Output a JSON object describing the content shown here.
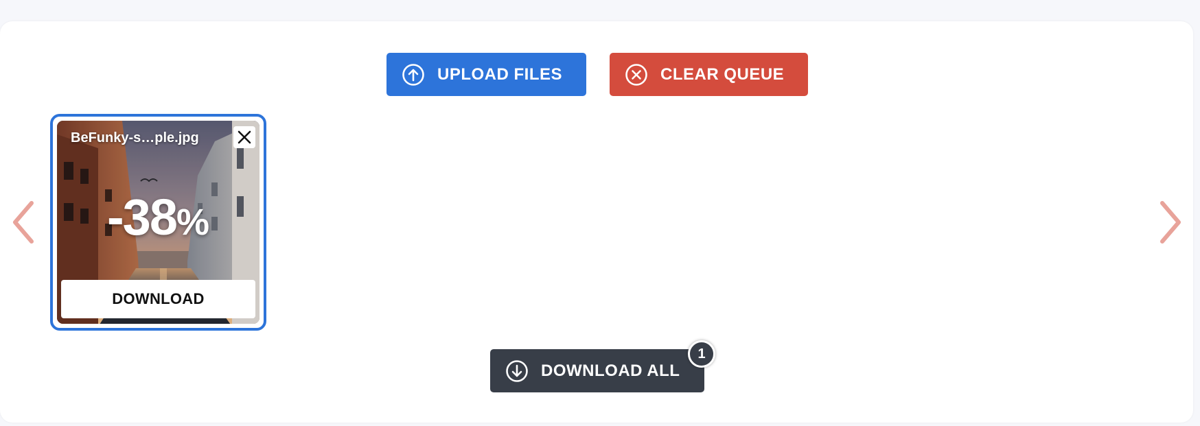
{
  "toolbar": {
    "upload_label": "UPLOAD FILES",
    "clear_label": "CLEAR QUEUE",
    "upload_icon": "arrow-up-circle-icon",
    "clear_icon": "x-circle-icon"
  },
  "queue": {
    "items": [
      {
        "filename": "BeFunky-s…ple.jpg",
        "reduction": "-38",
        "reduction_symbol": "%",
        "download_label": "DOWNLOAD"
      }
    ]
  },
  "footer": {
    "download_all_label": "DOWNLOAD ALL",
    "count": "1",
    "download_all_icon": "arrow-down-circle-icon"
  },
  "colors": {
    "upload": "#2d74da",
    "clear": "#d44c3d",
    "download_all": "#383e48",
    "nav_arrow": "#e8a39a",
    "card_border": "#2d74da"
  }
}
